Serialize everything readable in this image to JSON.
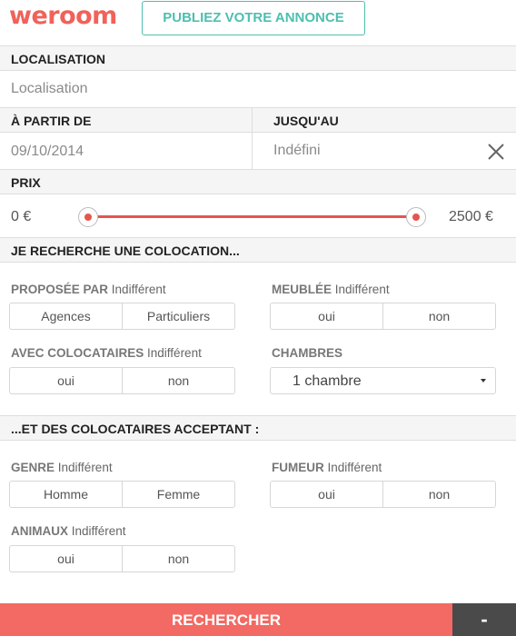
{
  "header": {
    "logo": "weroom",
    "publish_label": "PUBLIEZ VOTRE ANNONCE"
  },
  "location": {
    "label": "LOCALISATION",
    "placeholder": "Localisation"
  },
  "dates": {
    "from_label": "À PARTIR DE",
    "from_value": "09/10/2014",
    "to_label": "JUSQU'AU",
    "to_value": "Indéfini"
  },
  "price": {
    "label": "PRIX",
    "min": "0 €",
    "max": "2500 €"
  },
  "colocation": {
    "heading": "JE RECHERCHE UNE COLOCATION...",
    "proposed_by": {
      "label": "PROPOSÉE PAR",
      "value": "Indifférent",
      "options": [
        "Agences",
        "Particuliers"
      ]
    },
    "furnished": {
      "label": "MEUBLÉE",
      "value": "Indifférent",
      "options": [
        "oui",
        "non"
      ]
    },
    "with_roommates": {
      "label": "AVEC COLOCATAIRES",
      "value": "Indifférent",
      "options": [
        "oui",
        "non"
      ]
    },
    "rooms": {
      "label": "CHAMBRES",
      "selected": "1 chambre"
    }
  },
  "roommates": {
    "heading": "...ET DES COLOCATAIRES ACCEPTANT :",
    "gender": {
      "label": "GENRE",
      "value": "Indifférent",
      "options": [
        "Homme",
        "Femme"
      ]
    },
    "smoker": {
      "label": "FUMEUR",
      "value": "Indifférent",
      "options": [
        "oui",
        "non"
      ]
    },
    "animals": {
      "label": "ANIMAUX",
      "value": "Indifférent",
      "options": [
        "oui",
        "non"
      ]
    }
  },
  "footer": {
    "search_label": "RECHERCHER",
    "collapse_label": "-"
  }
}
